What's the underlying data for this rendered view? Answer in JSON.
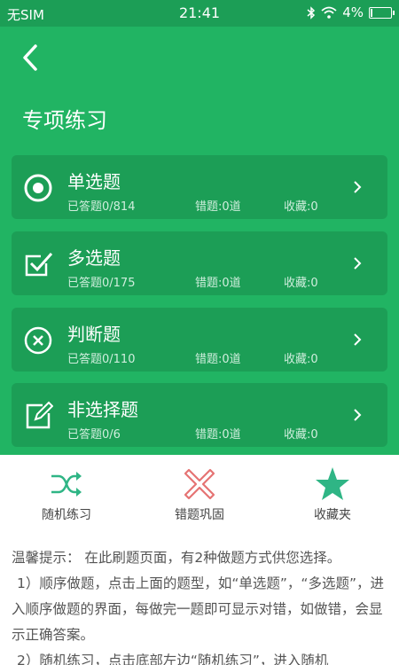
{
  "status_bar": {
    "carrier": "无SIM",
    "time": "21:41",
    "battery": "4%"
  },
  "header": {
    "title": "专项练习"
  },
  "categories": [
    {
      "name": "单选题",
      "answered": "已答题0/814",
      "errors": "错题:0道",
      "favorites": "收藏:0",
      "icon": "radio-icon"
    },
    {
      "name": "多选题",
      "answered": "已答题0/175",
      "errors": "错题:0道",
      "favorites": "收藏:0",
      "icon": "checkbox-icon"
    },
    {
      "name": "判断题",
      "answered": "已答题0/110",
      "errors": "错题:0道",
      "favorites": "收藏:0",
      "icon": "cross-circle-icon"
    },
    {
      "name": "非选择题",
      "answered": "已答题0/6",
      "errors": "错题:0道",
      "favorites": "收藏:0",
      "icon": "edit-icon"
    }
  ],
  "actions": [
    {
      "label": "随机练习",
      "icon": "shuffle-icon",
      "color": "#2fb585"
    },
    {
      "label": "错题巩固",
      "icon": "x-icon",
      "color": "#e57373"
    },
    {
      "label": "收藏夹",
      "icon": "star-icon",
      "color": "#2fb585"
    }
  ],
  "tips": [
    "温馨提示： 在此刷题页面，有2种做题方式供您选择。",
    "1）顺序做题，点击上面的题型，如“单选题”，“多选题”，进入顺序做题的界面，每做完一题即可显示对错，如做错，会显示正确答案。",
    "2）随机练习，点击底部左边“随机练习”，进入随机"
  ],
  "colors": {
    "primary_green": "#21b463",
    "card_green": "#1c9e56"
  }
}
